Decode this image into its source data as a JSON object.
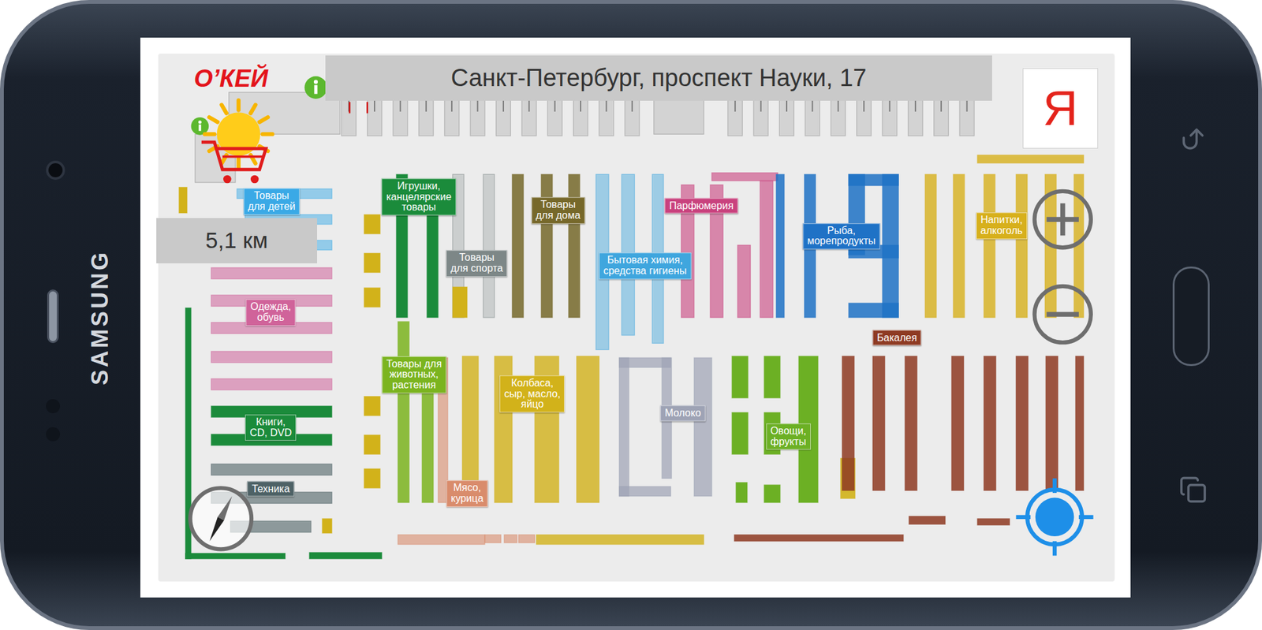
{
  "device": {
    "brand": "SAMSUNG"
  },
  "header": {
    "logo": "О’КЕЙ",
    "address": "Санкт-Петербург, проспект Науки, 17",
    "provider_logo": "Я"
  },
  "distance": "5,1 км",
  "sections": [
    {
      "label": "Товары\nдля детей",
      "color": "#3aa9e6"
    },
    {
      "label": "Игрушки,\nканцелярские\nтовары",
      "color": "#1b8b3b"
    },
    {
      "label": "Товары\nдля дома",
      "color": "#76682a"
    },
    {
      "label": "Товары\nдля спорта",
      "color": "#7d8787"
    },
    {
      "label": "Парфюмерия",
      "color": "#c9427e"
    },
    {
      "label": "Бытовая химия,\nсредства гигиены",
      "color": "#3fa6de"
    },
    {
      "label": "Рыба,\nморепродукты",
      "color": "#1f72c6"
    },
    {
      "label": "Напитки,\nалкоголь",
      "color": "#d7b01c"
    },
    {
      "label": "Одежда,\nобувь",
      "color": "#d0639a"
    },
    {
      "label": "Бакалея",
      "color": "#8e3a22"
    },
    {
      "label": "Товары для\nживотных,\nрастения",
      "color": "#7bb41f"
    },
    {
      "label": "Колбаса,\nсыр, масло,\nяйцо",
      "color": "#d2b21a"
    },
    {
      "label": "Молоко",
      "color": "#9ea3b5"
    },
    {
      "label": "Овощи,\nфрукты",
      "color": "#6cb024"
    },
    {
      "label": "Книги,\nCD, DVD",
      "color": "#1b8b3b"
    },
    {
      "label": "Техника",
      "color": "#4e6266"
    },
    {
      "label": "Мясо,\nкурица",
      "color": "#d98c6c"
    }
  ]
}
